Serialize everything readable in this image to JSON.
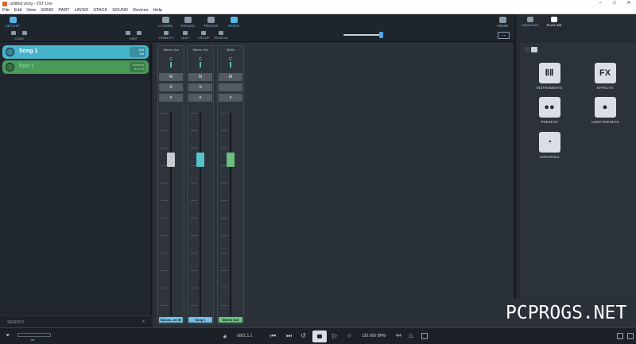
{
  "window": {
    "title": "untitled.vlsng - VST Live",
    "controls": [
      "–",
      "□",
      "✕"
    ]
  },
  "menu": [
    "File",
    "Edit",
    "View",
    "SONG",
    "PART",
    "LAYER",
    "STACK",
    "SOUND",
    "Devices",
    "Help"
  ],
  "toolbar": {
    "setlist": "SETLIST",
    "song": "SONG",
    "part": "PART",
    "tabs": [
      {
        "label": "LAYERS",
        "icon": "layers-icon"
      },
      {
        "label": "STACKS",
        "icon": "stacks-icon"
      },
      {
        "label": "TRACKS",
        "icon": "tracks-icon"
      },
      {
        "label": "MIXER",
        "icon": "mixer-icon",
        "active": true
      }
    ],
    "sub": [
      {
        "label": "VISIBILITY",
        "icon": "eye-icon"
      },
      {
        "label": "QUIT",
        "icon": "quit-icon"
      },
      {
        "label": "GROUP",
        "icon": "group-icon"
      },
      {
        "label": "REMOVE",
        "icon": "trash-icon"
      }
    ],
    "views": "VIEWS",
    "zoom_fraction": 0.94
  },
  "setlist": {
    "song": {
      "name": "Song 1",
      "tempo": "120",
      "signature": "4/4"
    },
    "part": {
      "name": "Part 1",
      "info_line1": "Stacked",
      "info_line2": "0.0.0.0"
    }
  },
  "search": {
    "label": "SEARCH",
    "clear": "x"
  },
  "mixer": {
    "strips": [
      {
        "out": "Stereo Out",
        "pan": "C",
        "m": "M",
        "s": "S",
        "e": "e",
        "name": "NALaa...nn 00",
        "fader_color": "#c8ccd0",
        "name_color": "#6fc2e8"
      },
      {
        "out": "Stereo Out",
        "pan": "C",
        "m": "M",
        "s": "S",
        "e": "e",
        "name": "Song 1",
        "fader_color": "#56c4c8",
        "name_color": "#6fc2e8"
      },
      {
        "out": "MAIN",
        "pan": "C",
        "m": "M",
        "s": "",
        "e": "e",
        "name": "Stereo Out",
        "fader_color": "#6ac07c",
        "name_color": "#6ac07c"
      }
    ]
  },
  "right": {
    "tabs": [
      {
        "label": "MEDIA BAY",
        "icon": "mediabay-icon"
      },
      {
        "label": "PLUG INS",
        "icon": "plugins-icon",
        "active": true
      }
    ],
    "plugins": [
      {
        "label": "INSTRUMENTS",
        "icon": "piano-icon",
        "glyph": "ⅡⅡ"
      },
      {
        "label": "EFFECTS",
        "icon": "fx-icon",
        "glyph": "FX"
      },
      {
        "label": "PRESETS",
        "icon": "presets-icon",
        "glyph": "●●"
      },
      {
        "label": "USER PRESETS",
        "icon": "user-presets-icon",
        "glyph": "●"
      },
      {
        "label": "CONTROLS",
        "icon": "knob-icon",
        "glyph": "◔"
      }
    ]
  },
  "transport": {
    "position": "0001.1.1",
    "tempo": "120.000 BPM",
    "signature": "4/4",
    "meter_left": "-inf"
  },
  "watermark": "PCPROGS.NET"
}
